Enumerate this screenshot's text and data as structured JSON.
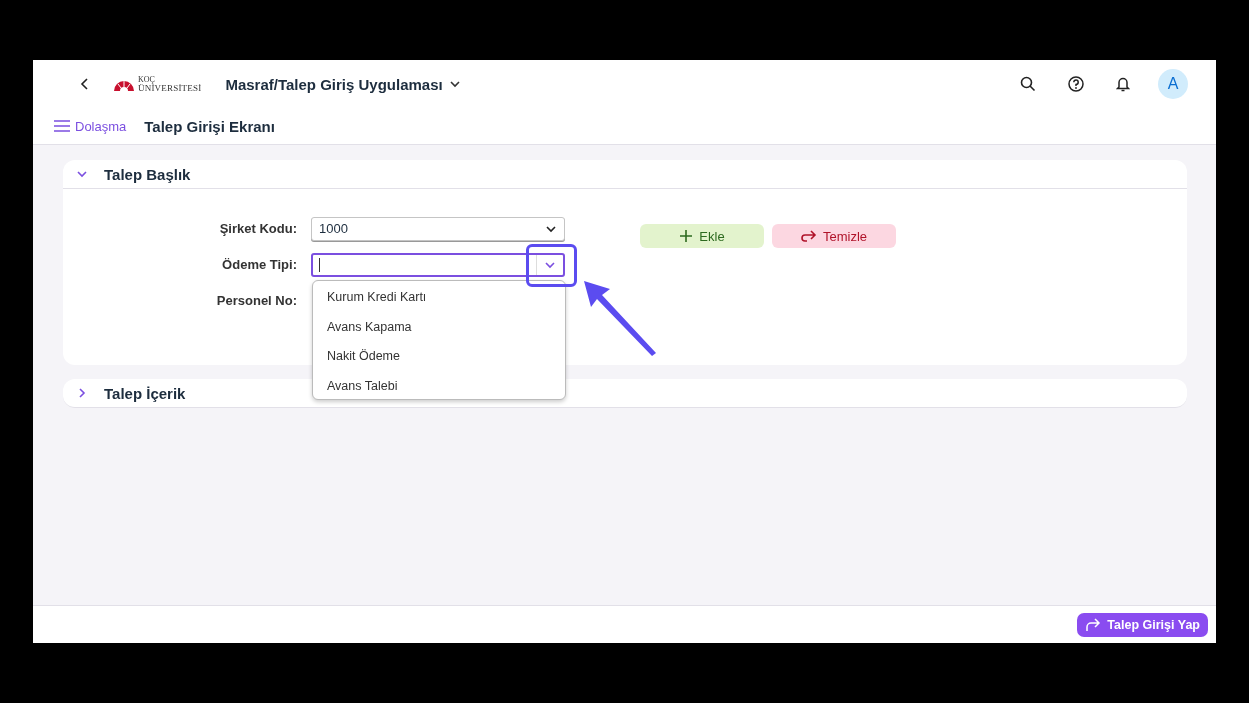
{
  "shell": {
    "logo": {
      "line1": "KOÇ",
      "line2": "ÜNİVERSİTESİ"
    },
    "title": "Masraf/Talep Giriş Uygulaması",
    "avatar": "A"
  },
  "subheader": {
    "nav": "Dolaşma",
    "title": "Talep Girişi Ekranı"
  },
  "sections": [
    {
      "title": "Talep Başlık",
      "expanded": true,
      "fields": [
        {
          "kind": "select",
          "label": "Şirket Kodu:",
          "value": "1000",
          "expanded": false
        },
        {
          "kind": "select",
          "label": "Ödeme Tipi:",
          "expanded": true,
          "options": [
            "Kurum Kredi Kartı",
            "Avans Kapama",
            "Nakit Ödeme",
            "Avans Talebi"
          ]
        },
        {
          "kind": "label",
          "label": "Personel No:"
        }
      ],
      "buttons": [
        {
          "kind": "add",
          "label": "Ekle"
        },
        {
          "kind": "clear",
          "label": "Temizle"
        }
      ]
    },
    {
      "title": "Talep İçerik",
      "expanded": false
    }
  ],
  "footer": {
    "button": "Talep Girişi Yap"
  }
}
